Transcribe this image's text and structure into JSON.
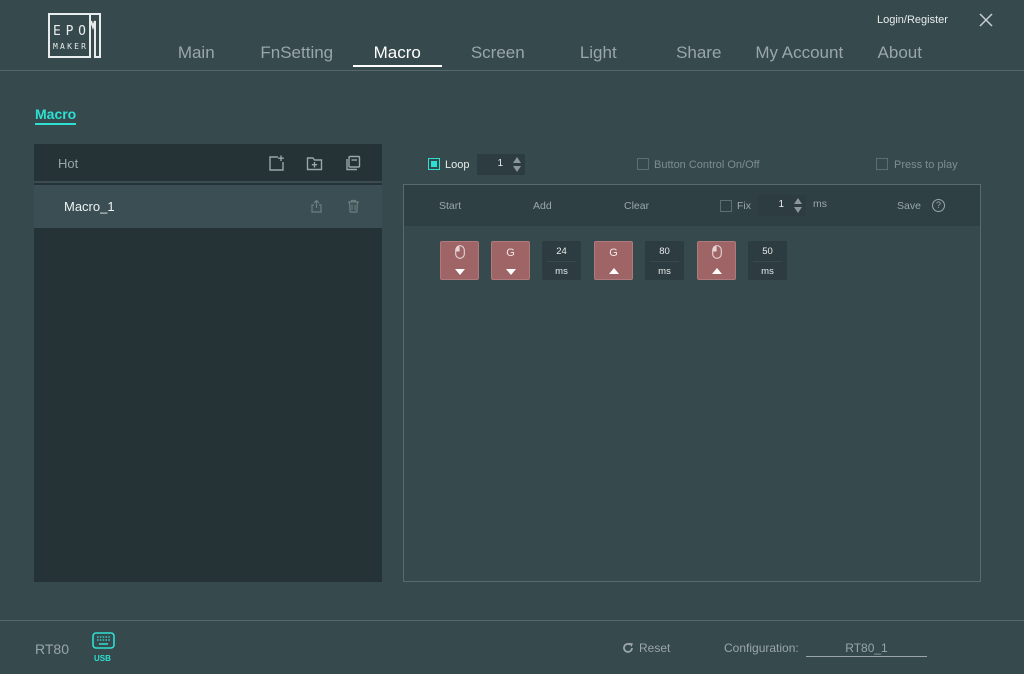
{
  "app": {
    "logo_alt": "EPOMAKER",
    "login_label": "Login/Register",
    "close_icon": "close-icon"
  },
  "nav": {
    "items": [
      {
        "label": "Main",
        "active": false
      },
      {
        "label": "FnSetting",
        "active": false
      },
      {
        "label": "Macro",
        "active": true
      },
      {
        "label": "Screen",
        "active": false
      },
      {
        "label": "Light",
        "active": false
      },
      {
        "label": "Share",
        "active": false
      },
      {
        "label": "My Account",
        "active": false
      },
      {
        "label": "About",
        "active": false
      }
    ]
  },
  "page": {
    "section_title": "Macro"
  },
  "macro_list": {
    "header_label": "Hot",
    "header_icons": [
      "new-macro-icon",
      "import-folder-icon",
      "copy-icon"
    ],
    "items": [
      {
        "name": "Macro_1",
        "icons": [
          "export-icon",
          "trash-icon"
        ]
      }
    ]
  },
  "options": {
    "loop": {
      "label": "Loop",
      "checked": true,
      "count": "1"
    },
    "button_control": {
      "label": "Button Control On/Off",
      "checked": false
    },
    "press_to_play": {
      "label": "Press to play",
      "checked": false
    }
  },
  "toolbar": {
    "start": "Start",
    "add": "Add",
    "clear": "Clear",
    "fix": {
      "label": "Fix",
      "checked": false,
      "value": "1",
      "unit": "ms"
    },
    "save": "Save",
    "help": "?"
  },
  "steps": [
    {
      "type": "key",
      "key": "mouse-left",
      "action": "down"
    },
    {
      "type": "key",
      "key": "G",
      "action": "down"
    },
    {
      "type": "delay",
      "value": "24",
      "unit": "ms"
    },
    {
      "type": "key",
      "key": "G",
      "action": "up"
    },
    {
      "type": "delay",
      "value": "80",
      "unit": "ms"
    },
    {
      "type": "key",
      "key": "mouse-left",
      "action": "up"
    },
    {
      "type": "delay",
      "value": "50",
      "unit": "ms"
    }
  ],
  "footer": {
    "device": "RT80",
    "connection": "USB",
    "reset_label": "Reset",
    "config_label": "Configuration:",
    "config_value": "RT80_1"
  },
  "colors": {
    "accent": "#2ee0d2",
    "background": "#36494d",
    "panel": "#253236",
    "key_step": "#9e6466"
  }
}
